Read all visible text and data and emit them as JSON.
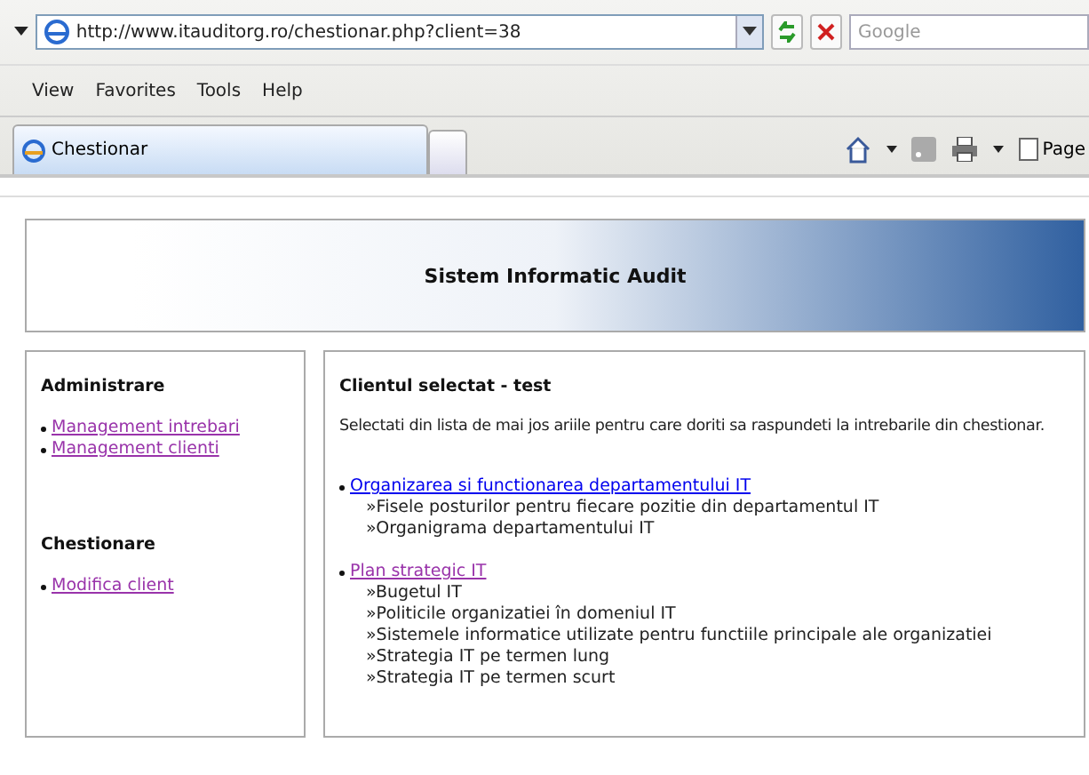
{
  "address_bar": {
    "url": "http://www.itauditorg.ro/chestionar.php?client=38"
  },
  "search": {
    "placeholder": "Google"
  },
  "menu": [
    "View",
    "Favorites",
    "Tools",
    "Help"
  ],
  "tabs": [
    {
      "label": "Chestionar",
      "selected": true
    }
  ],
  "toolbar": {
    "page_label": "Page"
  },
  "banner": {
    "title": "Sistem Informatic Audit"
  },
  "sidebar": {
    "sections": [
      {
        "heading": "Administrare",
        "links": [
          {
            "label": "Management intrebari",
            "visited": true
          },
          {
            "label": "Management clienti",
            "visited": true
          }
        ]
      },
      {
        "heading": "Chestionare",
        "links": [
          {
            "label": "Modifica client",
            "visited": true
          }
        ]
      }
    ]
  },
  "content": {
    "heading": "Clientul selectat - test",
    "intro": "Selectati din lista de mai jos ariile pentru care doriti sa raspundeti la intrebarile din chestionar.",
    "areas": [
      {
        "label": "Organizarea si functionarea departamentului IT",
        "visited": false,
        "items": [
          "»Fisele posturilor pentru fiecare pozitie din departamentul IT",
          "»Organigrama departamentului IT"
        ]
      },
      {
        "label": "Plan strategic IT",
        "visited": true,
        "items": [
          "»Bugetul IT",
          "»Politicile organizatiei în domeniul IT",
          "»Sistemele informatice utilizate pentru functiile principale ale organizatiei",
          "»Strategia IT pe termen lung",
          "»Strategia IT pe termen scurt"
        ]
      }
    ]
  }
}
